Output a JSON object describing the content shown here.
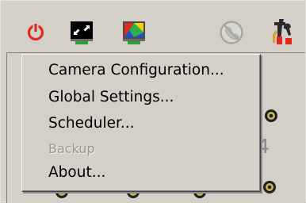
{
  "toolbar": {
    "buttons": [
      {
        "name": "power-icon",
        "color": "#e12a1f"
      },
      {
        "name": "restore-window-icon"
      },
      {
        "name": "color-display-icon"
      },
      {
        "name": "no-phone-icon"
      },
      {
        "name": "tools-icon"
      }
    ]
  },
  "menu": {
    "items": [
      {
        "label": "Camera Configuration...",
        "enabled": true
      },
      {
        "label": "Global Settings...",
        "enabled": true
      },
      {
        "label": "Scheduler...",
        "enabled": true
      },
      {
        "label": "Backup",
        "enabled": false
      },
      {
        "label": "About...",
        "enabled": true
      }
    ]
  },
  "background": {
    "partial_digit": "4"
  }
}
